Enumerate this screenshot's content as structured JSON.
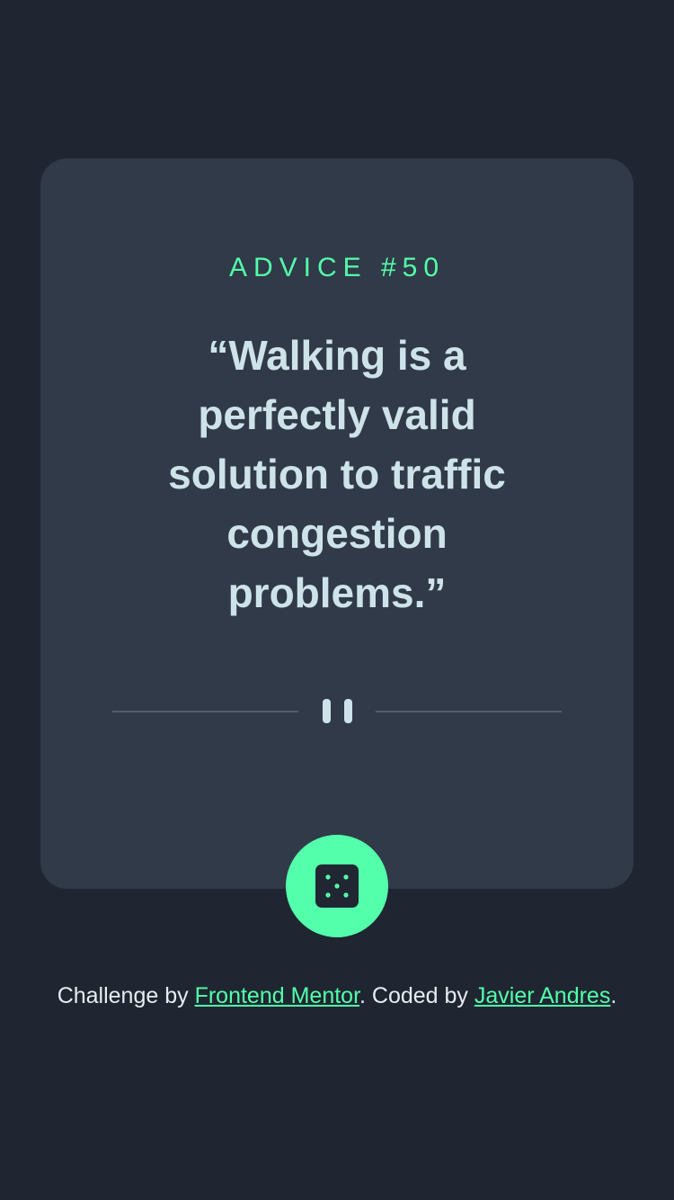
{
  "card": {
    "advice_label": "ADVICE #",
    "advice_number": "50",
    "quote": "“Walking is a perfectly valid solution to traffic congestion problems.”"
  },
  "dice_button": {
    "icon": "dice-icon",
    "aria_label": "Get new advice"
  },
  "footer": {
    "prefix": "Challenge by ",
    "link1": "Frontend Mentor",
    "middle": ". Coded by ",
    "link2": "Javier Andres",
    "suffix": "."
  },
  "colors": {
    "background": "#1f2631",
    "card": "#313a48",
    "accent": "#53ffaa",
    "quote_text": "#cee3e9",
    "divider": "#4f5d74"
  }
}
